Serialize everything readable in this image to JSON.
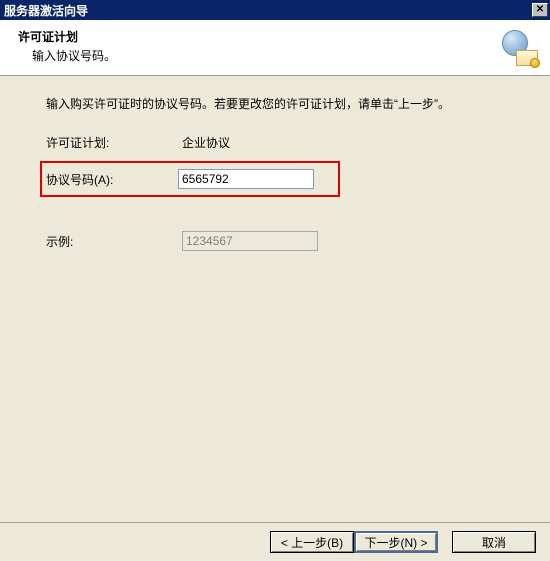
{
  "window": {
    "title": "服务器激活向导"
  },
  "header": {
    "title": "许可证计划",
    "subtitle": "输入协议号码。"
  },
  "content": {
    "instruction": "输入购买许可证时的协议号码。若要更改您的许可证计划，请单击“上一步”。",
    "plan_label": "许可证计划:",
    "plan_value": "企业协议",
    "agreement_label": "协议号码(A):",
    "agreement_input": "6565792",
    "example_label": "示例:",
    "example_value": "1234567"
  },
  "footer": {
    "back": "< 上一步(B)",
    "next": "下一步(N) >",
    "cancel": "取消"
  }
}
